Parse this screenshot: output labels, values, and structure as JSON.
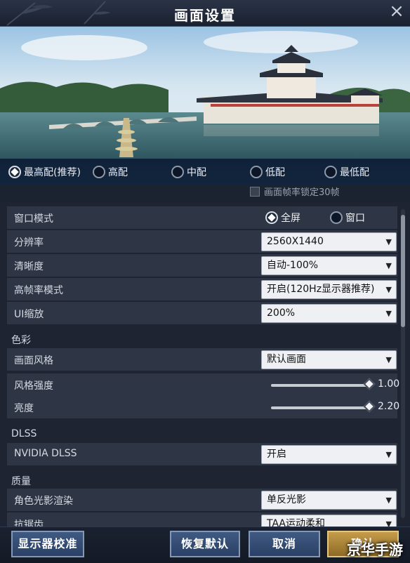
{
  "window": {
    "title": "画面设置"
  },
  "presets": [
    {
      "label": "最高配(推荐)",
      "selected": true
    },
    {
      "label": "高配",
      "selected": false
    },
    {
      "label": "中配",
      "selected": false
    },
    {
      "label": "低配",
      "selected": false
    },
    {
      "label": "最低配",
      "selected": false
    }
  ],
  "frame_lock": {
    "label": "画面帧率锁定30帧",
    "checked": false
  },
  "settings": {
    "window_mode": {
      "label": "窗口模式",
      "options": [
        "全屏",
        "窗口"
      ],
      "selected": "全屏"
    },
    "resolution": {
      "label": "分辨率",
      "value": "2560X1440"
    },
    "clarity": {
      "label": "清晰度",
      "value": "自动-100%"
    },
    "high_fps": {
      "label": "高帧率模式",
      "value": "开启(120Hz显示器推荐)"
    },
    "ui_scale": {
      "label": "UI缩放",
      "value": "200%"
    },
    "color_section": "色彩",
    "style": {
      "label": "画面风格",
      "value": "默认画面"
    },
    "style_strength": {
      "label": "风格强度",
      "value": "1.00",
      "fraction": 1.0
    },
    "brightness": {
      "label": "亮度",
      "value": "2.20",
      "fraction": 1.0
    },
    "dlss_section": "DLSS",
    "nvidia_dlss": {
      "label": "NVIDIA DLSS",
      "value": "开启"
    },
    "quality_section": "质量",
    "char_shadow": {
      "label": "角色光影渲染",
      "value": "单反光影"
    },
    "antialias": {
      "label": "抗锯齿",
      "value": "TAA运动柔和"
    }
  },
  "buttons": {
    "calibrate": "显示器校准",
    "restore": "恢复默认",
    "cancel": "取消",
    "confirm": "确认"
  },
  "watermark": "京华手游",
  "colors": {
    "accent_blue": "#3f5a82",
    "accent_gold": "#c49c4a",
    "panel": "#1e2431"
  }
}
